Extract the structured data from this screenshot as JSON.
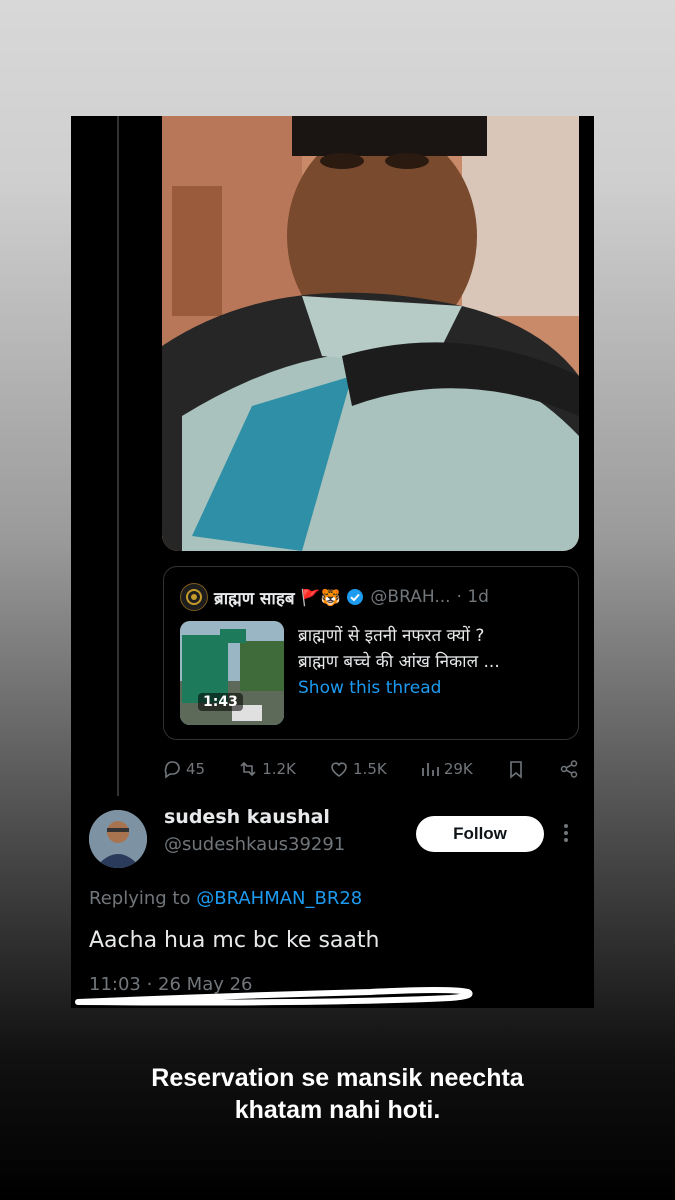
{
  "quoted_post": {
    "author_name": "ब्राह्मण साहब",
    "author_emoji": "🚩🐯",
    "author_handle": "@BRAH...",
    "time": "· 1d",
    "text_line1": "ब्राह्मणों से इतनी नफरत क्यों ?",
    "text_line2": "ब्राह्मण बच्चे की आंख निकाल ...",
    "show_thread": "Show this thread",
    "video_duration": "1:43"
  },
  "actions": {
    "replies": "45",
    "reposts": "1.2K",
    "likes": "1.5K",
    "views": "29K"
  },
  "reply": {
    "name": "sudesh kaushal",
    "handle": "@sudeshkaus39291",
    "follow_label": "Follow",
    "replying_prefix": "Replying to",
    "replying_to": "@BRAHMAN_BR28",
    "text": "Aacha hua mc bc ke saath",
    "timestamp": "11:03 · 26 May 26"
  },
  "caption": {
    "line1": "Reservation se mansik neechta",
    "line2": "khatam nahi hoti."
  },
  "colors": {
    "link": "#1d9bf0",
    "muted": "#71767b",
    "text": "#e7e9ea",
    "background": "#000000"
  }
}
